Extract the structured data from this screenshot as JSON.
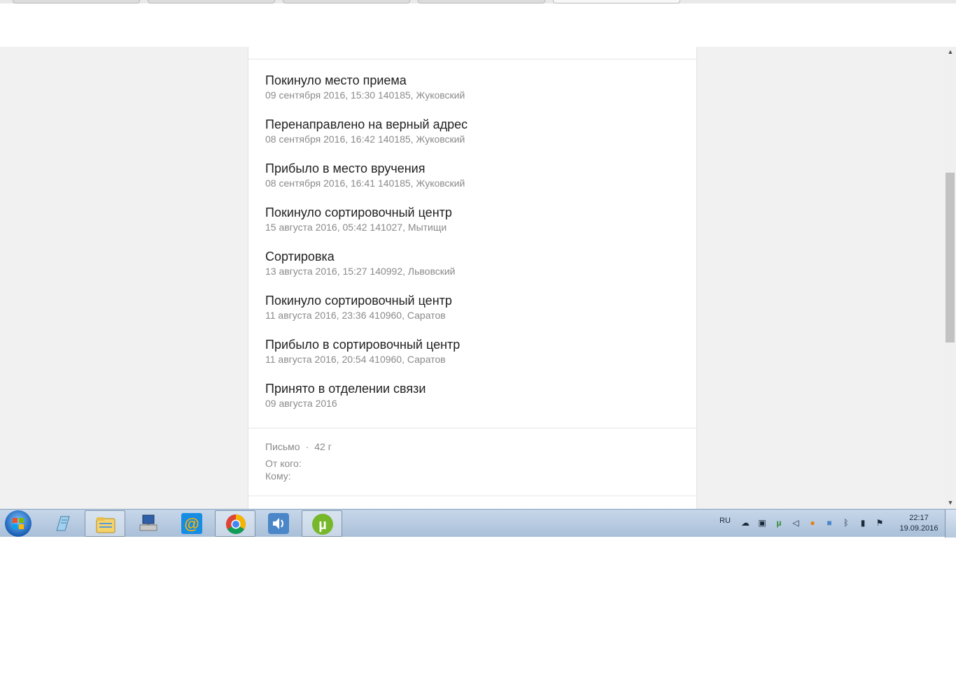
{
  "events": [
    {
      "title": "Покинуло место приема",
      "meta": "09 сентября 2016, 15:30 140185, Жуковский"
    },
    {
      "title": "Перенаправлено на верный адрес",
      "meta": "08 сентября 2016, 16:42 140185, Жуковский"
    },
    {
      "title": "Прибыло в место вручения",
      "meta": "08 сентября 2016, 16:41 140185, Жуковский"
    },
    {
      "title": "Покинуло сортировочный центр",
      "meta": "15 августа 2016, 05:42 141027, Мытищи"
    },
    {
      "title": "Сортировка",
      "meta": "13 августа 2016, 15:27 140992, Львовский"
    },
    {
      "title": "Покинуло сортировочный центр",
      "meta": "11 августа 2016, 23:36 410960, Саратов"
    },
    {
      "title": "Прибыло в сортировочный центр",
      "meta": "11 августа 2016, 20:54 410960, Саратов"
    },
    {
      "title": "Принято в отделении связи",
      "meta": "09 августа 2016"
    }
  ],
  "info": {
    "type": "Письмо",
    "separator": "·",
    "weight": "42 г",
    "from_label": "От кого:",
    "to_label": "Кому:"
  },
  "taskbar": {
    "apps": [
      "start-orb",
      "notepad",
      "explorer",
      "network-computer",
      "mail-ru-agent",
      "chrome",
      "volume-app",
      "utorrent"
    ],
    "language": "RU",
    "time": "22:17",
    "date": "19.09.2016"
  },
  "colors": {
    "page_bg": "#f1f1f1",
    "card_bg": "#ffffff",
    "title_text": "#222222",
    "meta_text": "#8a8a8a",
    "taskbar": "#b9cbe0"
  }
}
